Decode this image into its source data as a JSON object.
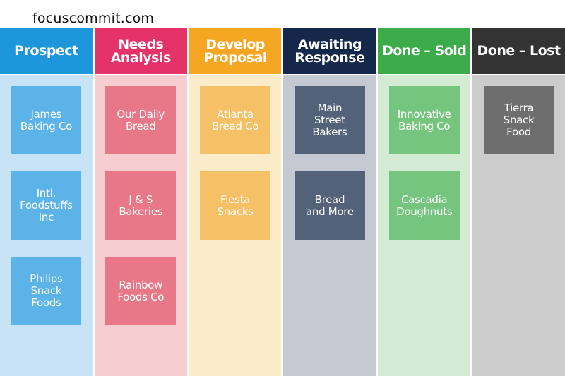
{
  "site": "focuscommit.com",
  "columns": [
    {
      "title": "Prospect",
      "header_color": "#1e96dc",
      "body_color": "#c8e3f5",
      "card_color": "#5cb3e8",
      "cards": [
        "James\nBaking Co",
        "Intl.\nFoodstuffs\nInc",
        "Philips\nSnack\nFoods"
      ]
    },
    {
      "title": "Needs\nAnalysis",
      "header_color": "#e5336a",
      "body_color": "#f6cdd0",
      "card_color": "#e87787",
      "cards": [
        "Our Daily\nBread",
        "J & S\nBakeries",
        "Rainbow\nFoods Co"
      ]
    },
    {
      "title": "Develop\nProposal",
      "header_color": "#f5a623",
      "body_color": "#fcebc9",
      "card_color": "#f5c066",
      "cards": [
        "Atlanta\nBread Co",
        "Fiesta\nSnacks"
      ]
    },
    {
      "title": "Awaiting\nResponse",
      "header_color": "#14284b",
      "body_color": "#c5cad2",
      "card_color": "#536179",
      "cards": [
        "Main\nStreet\nBakers",
        "Bread\nand More"
      ]
    },
    {
      "title": "Done – Sold",
      "header_color": "#3cac4a",
      "body_color": "#d4ebd3",
      "card_color": "#76c57e",
      "cards": [
        "Innovative\nBaking Co",
        "Cascadia\nDoughnuts"
      ]
    },
    {
      "title": "Done – Lost",
      "header_color": "#333333",
      "body_color": "#cccccc",
      "card_color": "#6e6e6e",
      "cards": [
        "Tierra\nSnack\nFood"
      ]
    }
  ]
}
